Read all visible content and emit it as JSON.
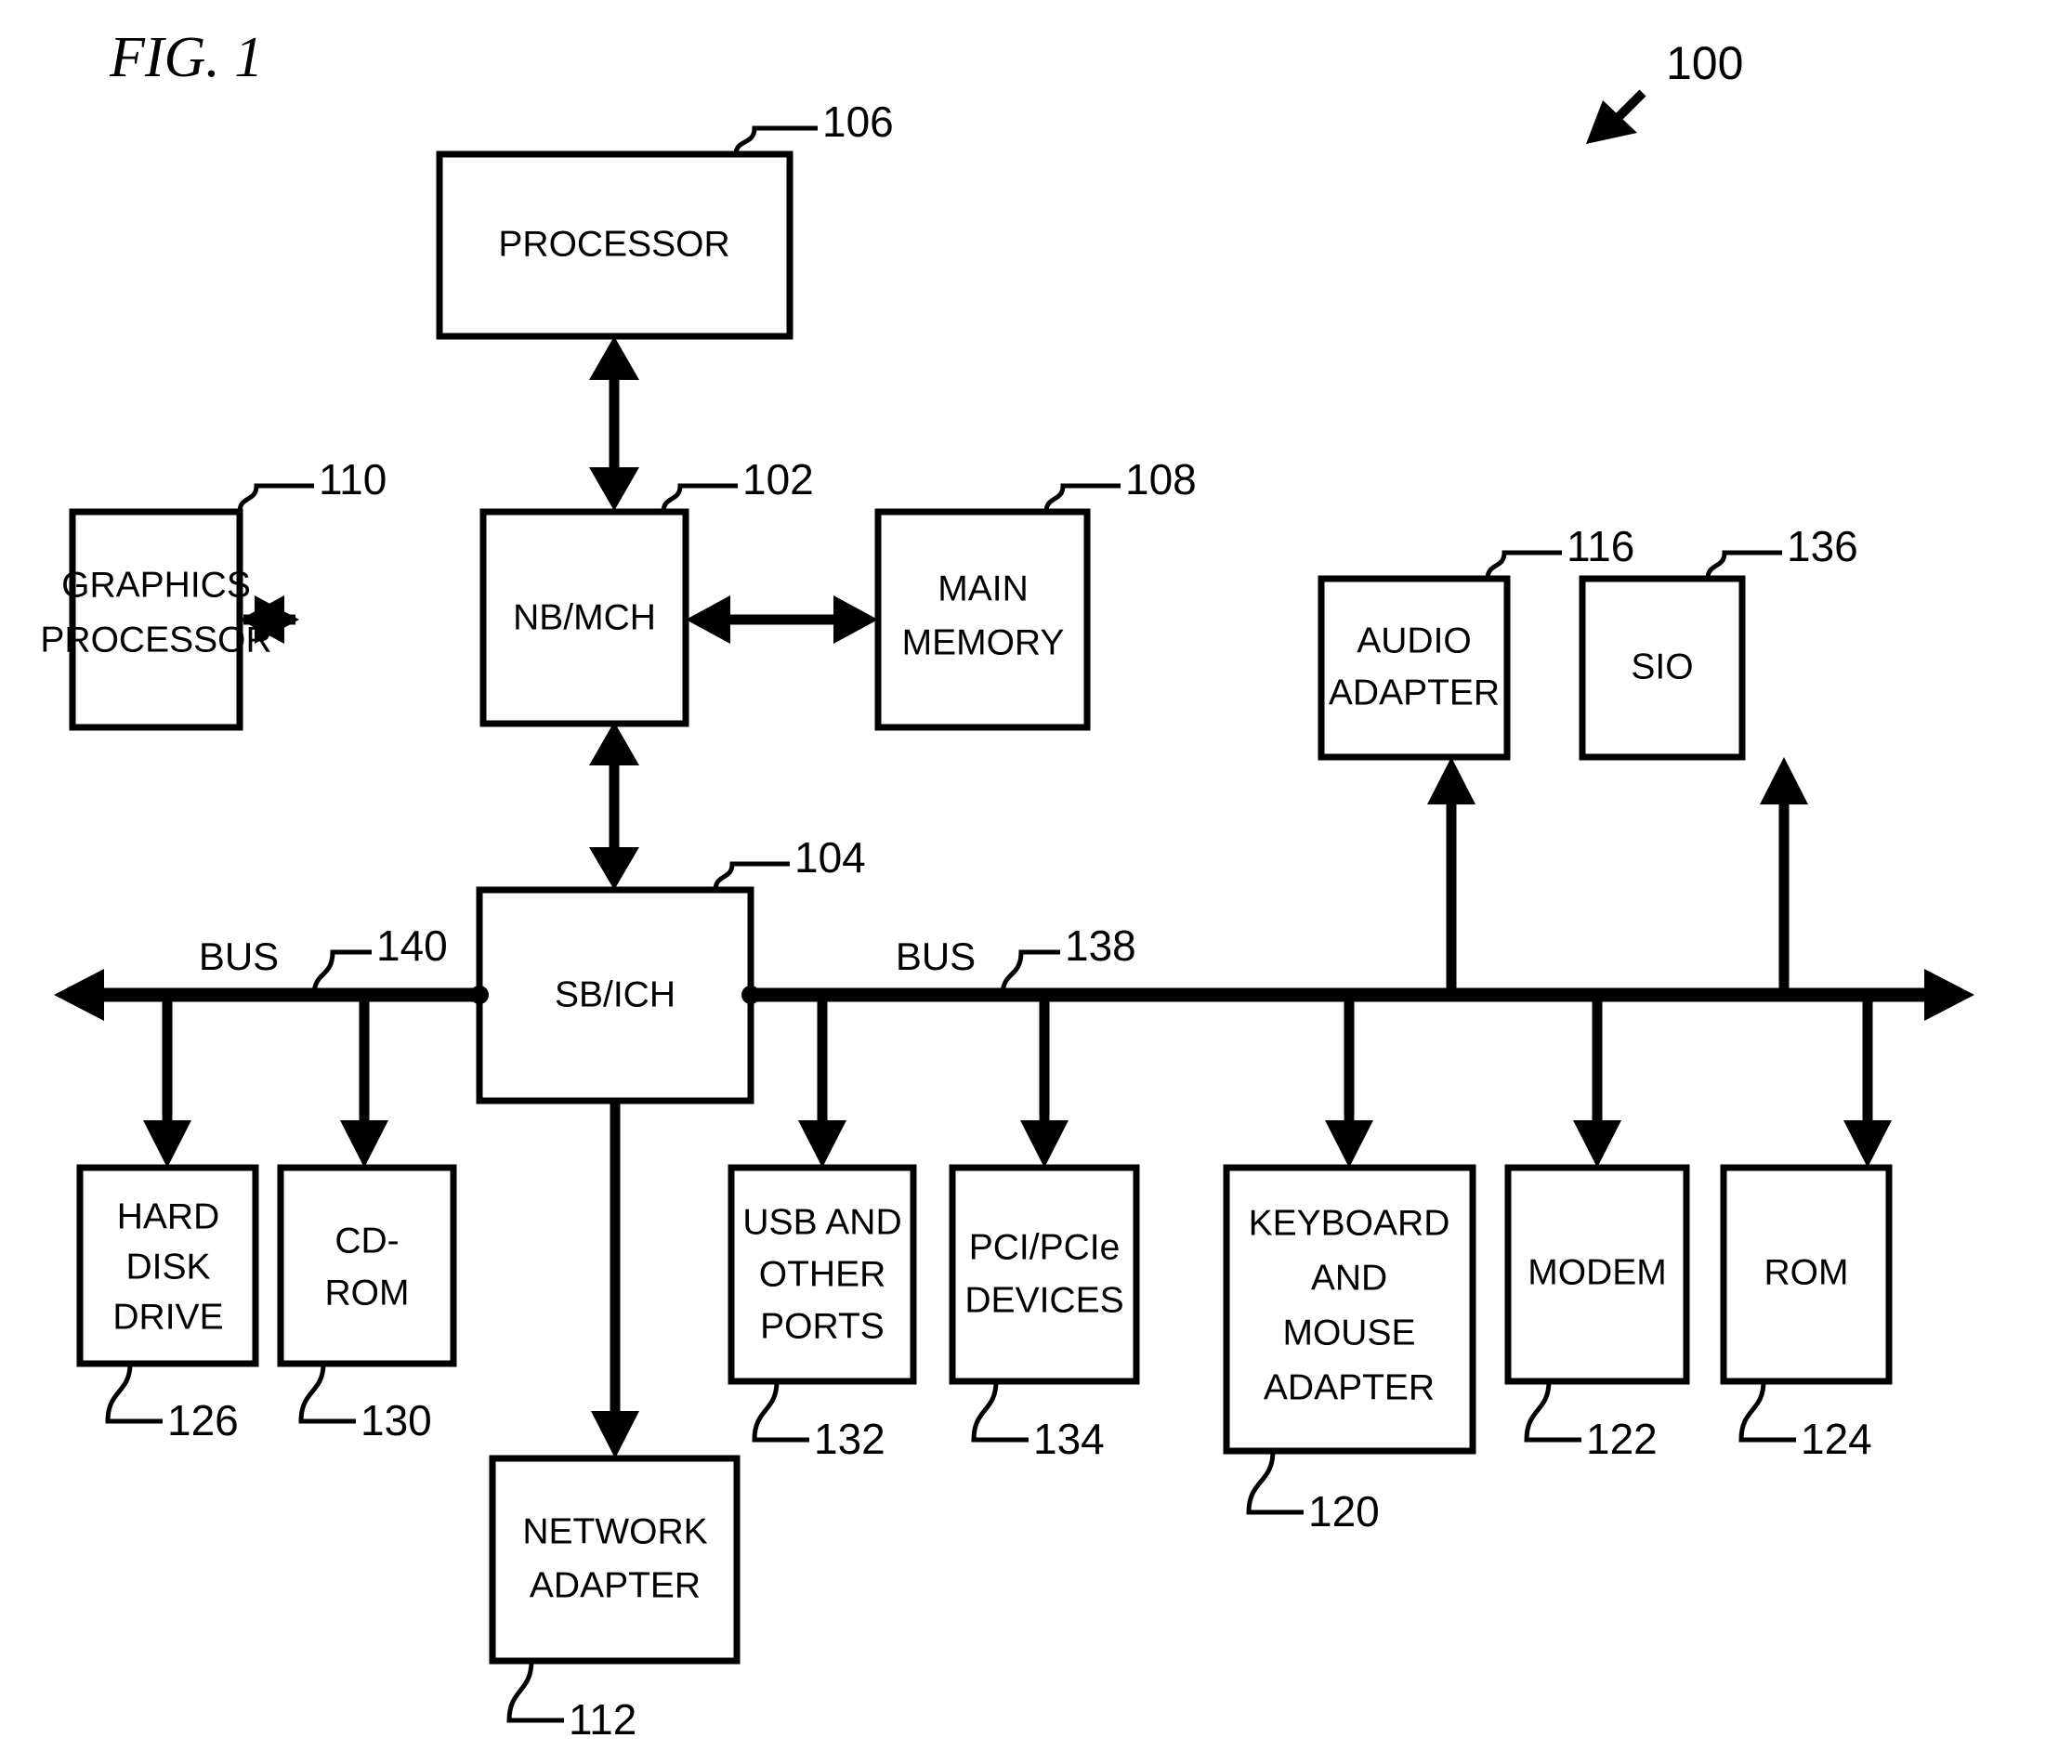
{
  "figure": {
    "title": "FIG. 1",
    "system_ref": "100"
  },
  "bus_labels": {
    "left": "BUS",
    "left_ref": "140",
    "right": "BUS",
    "right_ref": "138"
  },
  "blocks": {
    "processor": {
      "label": "PROCESSOR",
      "ref": "106"
    },
    "graphics": {
      "label_line1": "GRAPHICS",
      "label_line2": "PROCESSOR",
      "ref": "110"
    },
    "nbmch": {
      "label": "NB/MCH",
      "ref": "102"
    },
    "main_memory": {
      "label_line1": "MAIN",
      "label_line2": "MEMORY",
      "ref": "108"
    },
    "audio_adapter": {
      "label_line1": "AUDIO",
      "label_line2": "ADAPTER",
      "ref": "116"
    },
    "sio": {
      "label": "SIO",
      "ref": "136"
    },
    "sbich": {
      "label": "SB/ICH",
      "ref": "104"
    },
    "hard_disk_drive": {
      "label_line1": "HARD",
      "label_line2": "DISK",
      "label_line3": "DRIVE",
      "ref": "126"
    },
    "cd_rom": {
      "label_line1": "CD-",
      "label_line2": "ROM",
      "ref": "130"
    },
    "network_adapter": {
      "label_line1": "NETWORK",
      "label_line2": "ADAPTER",
      "ref": "112"
    },
    "usb_ports": {
      "label_line1": "USB AND",
      "label_line2": "OTHER",
      "label_line3": "PORTS",
      "ref": "132"
    },
    "pci_devices": {
      "label_line1": "PCI/PCIe",
      "label_line2": "DEVICES",
      "ref": "134"
    },
    "keyboard_mouse": {
      "label_line1": "KEYBOARD",
      "label_line2": "AND",
      "label_line3": "MOUSE",
      "label_line4": "ADAPTER",
      "ref": "120"
    },
    "modem": {
      "label": "MODEM",
      "ref": "122"
    },
    "rom": {
      "label": "ROM",
      "ref": "124"
    }
  },
  "colors": {
    "ink": "#000000",
    "paper": "#ffffff"
  }
}
